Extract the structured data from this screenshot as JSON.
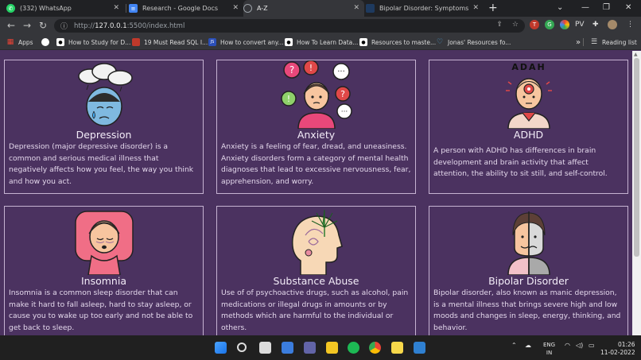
{
  "browser": {
    "tabs": [
      {
        "label": "(332) WhatsApp",
        "favicon": "whatsapp-icon",
        "color": "#25d366"
      },
      {
        "label": "Research - Google Docs",
        "favicon": "google-docs-icon",
        "color": "#4285f4"
      },
      {
        "label": "A-Z",
        "favicon": "globe-icon",
        "color": "#9aa0a6",
        "active": true
      },
      {
        "label": "Bipolar Disorder: Symptoms, Ca",
        "favicon": "site-icon",
        "color": "#1e3a5f"
      }
    ],
    "url_host": "127.0.0.1",
    "url_path": ":5500/index.html",
    "url_prefix": "http://",
    "extension_label": "PV",
    "reading_list": "Reading list",
    "bookmarks": [
      {
        "label": "Apps",
        "icon": "apps-grid-icon"
      },
      {
        "label": "",
        "icon": "github-icon"
      },
      {
        "label": "How to Study for D...",
        "icon": "medium-icon"
      },
      {
        "label": "19 Must Read SQL I...",
        "icon": "bookmark-icon"
      },
      {
        "label": "How to convert any...",
        "icon": "js-icon"
      },
      {
        "label": "How To Learn Data...",
        "icon": "medium-icon"
      },
      {
        "label": "Resources to maste...",
        "icon": "medium-icon"
      },
      {
        "label": "Jonas' Resources fo...",
        "icon": "heart-icon"
      }
    ],
    "bookmarks_more": "»"
  },
  "cards": [
    {
      "title": "Depression",
      "description": "Depression (major depressive disorder) is a common and serious medical illness that negatively affects how you feel, the way you think and how you act.",
      "illustration": "sad-face-with-clouds-icon"
    },
    {
      "title": "Anxiety",
      "description": "Anxiety is a feeling of fear, dread, and uneasiness. Anxiety disorders form a category of mental health diagnoses that lead to excessive nervousness, fear, apprehension, and worry.",
      "illustration": "anxious-person-with-speech-bubbles-icon"
    },
    {
      "title": "ADHD",
      "description": "A person with ADHD has differences in brain development and brain activity that affect attention, the ability to sit still, and self-control.",
      "illustration": "adhd-person-icon",
      "illustration_text": "ADAH"
    },
    {
      "title": "Insomnia",
      "description": "Insomnia is a common sleep disorder that can make it hard to fall asleep, hard to stay asleep, or cause you to wake up too early and not be able to get back to sleep.",
      "illustration": "tired-person-on-pillow-icon"
    },
    {
      "title": "Substance Abuse",
      "description": "Use of of psychoactive drugs, such as alcohol, pain medications or illegal drugs in amounts or by methods which are harmful to the individual or others.",
      "illustration": "head-with-cannabis-leaf-icon"
    },
    {
      "title": "Bipolar Disorder",
      "description": "Bipolar disorder, also known as manic depression, is a mental illness that brings severe high and low moods and changes in sleep, energy, thinking, and behavior.",
      "illustration": "split-face-person-icon"
    }
  ],
  "taskbar": {
    "language": "ENG",
    "region": "IN",
    "time": "01:26",
    "date": "11-02-2022"
  },
  "colors": {
    "page_background": "#4b3260",
    "card_border": "#c6b3d2",
    "text": "#e9dff0"
  }
}
